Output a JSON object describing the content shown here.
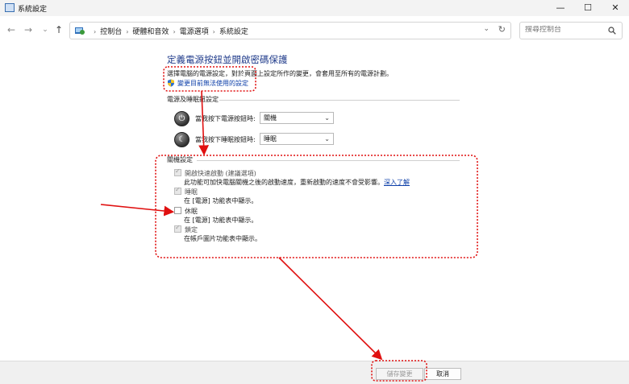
{
  "window": {
    "title": "系統設定",
    "controls": {
      "minimize": "—",
      "maximize": "☐",
      "close": "✕"
    }
  },
  "nav": {
    "back": "←",
    "forward": "→",
    "dropdown": "⌄",
    "up": "↑",
    "breadcrumbs": [
      "控制台",
      "硬體和音效",
      "電源選項",
      "系統設定"
    ],
    "crumb_separator": "›",
    "address_dropdown": "⌄",
    "refresh": "↻",
    "search_placeholder": "搜尋控制台"
  },
  "main": {
    "title": "定義電源按鈕並開啟密碼保護",
    "description": "選擇電腦的電源設定，對於頁面上設定所作的變更，會套用至所有的電源計劃。",
    "change_settings_link": "變更目前無法使用的設定",
    "power_section": {
      "heading": "電源及睡眠鈕設定",
      "power_button": {
        "label": "當我按下電源按鈕時:",
        "value": "關機"
      },
      "sleep_button": {
        "label": "當我按下睡眠按鈕時:",
        "value": "睡眠"
      }
    },
    "shutdown_section": {
      "heading": "關機設定",
      "items": [
        {
          "label": "開啟快速啟動 (建議選項)",
          "checked": true,
          "description": "此功能可加快電腦關機之後的啟動速度，重新啟動的速度不會受影響。",
          "link": "深入了解"
        },
        {
          "label": "睡眠",
          "checked": true,
          "description": "在 [電源] 功能表中顯示。"
        },
        {
          "label": "休眠",
          "checked": false,
          "description": "在 [電源] 功能表中顯示。"
        },
        {
          "label": "鎖定",
          "checked": true,
          "description": "在帳戶圖片功能表中顯示。"
        }
      ]
    }
  },
  "footer": {
    "save_label": "儲存變更",
    "cancel_label": "取消"
  },
  "colors": {
    "title_blue": "#1e3a8a",
    "link_blue": "#0b3ea8",
    "annotation_red": "#e01010"
  }
}
